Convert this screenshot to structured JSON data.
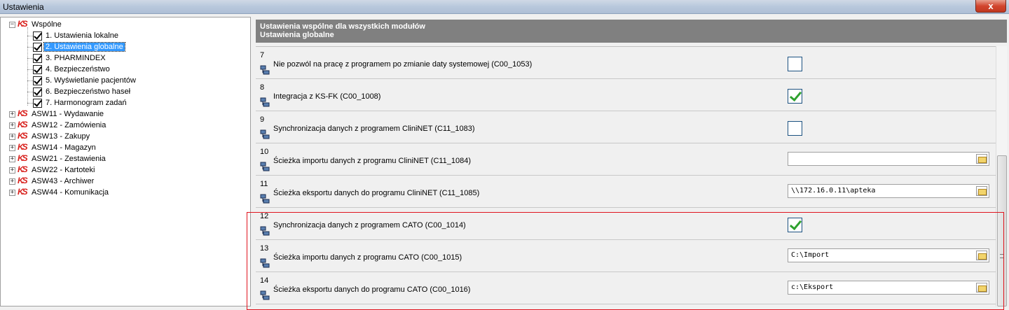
{
  "window": {
    "title": "Ustawienia",
    "close_label": "x"
  },
  "tree": {
    "root": {
      "label": "Wspólne",
      "expander": "−"
    },
    "children": [
      {
        "label": "1. Ustawienia lokalne",
        "selected": false
      },
      {
        "label": "2. Ustawienia globalne",
        "selected": true
      },
      {
        "label": "3. PHARMINDEX",
        "selected": false
      },
      {
        "label": "4. Bezpieczeństwo",
        "selected": false
      },
      {
        "label": "5. Wyświetlanie pacjentów",
        "selected": false
      },
      {
        "label": "6. Bezpieczeństwo haseł",
        "selected": false
      },
      {
        "label": "7. Harmonogram zadań",
        "selected": false
      }
    ],
    "modules": [
      {
        "label": "ASW11 - Wydawanie",
        "expander": "+"
      },
      {
        "label": "ASW12 - Zamówienia",
        "expander": "+"
      },
      {
        "label": "ASW13 - Zakupy",
        "expander": "+"
      },
      {
        "label": "ASW14 - Magazyn",
        "expander": "+"
      },
      {
        "label": "ASW21 - Zestawienia",
        "expander": "+"
      },
      {
        "label": "ASW22 - Kartoteki",
        "expander": "+"
      },
      {
        "label": "ASW43 - Archiwer",
        "expander": "+"
      },
      {
        "label": "ASW44 - Komunikacja",
        "expander": "+"
      }
    ]
  },
  "panel": {
    "header_line1": "Ustawienia wspólne dla wszystkich modułów",
    "header_line2": "Ustawienia globalne"
  },
  "settings": [
    {
      "num": "7",
      "label": "Nie pozwól na pracę z programem po zmianie daty systemowej (C00_1053)",
      "kind": "checkbox",
      "checked": false
    },
    {
      "num": "8",
      "label": "Integracja z KS-FK (C00_1008)",
      "kind": "checkbox",
      "checked": true
    },
    {
      "num": "9",
      "label": "Synchronizacja danych z programem CliniNET (C11_1083)",
      "kind": "checkbox",
      "checked": false
    },
    {
      "num": "10",
      "label": "Ścieżka importu danych z programu CliniNET (C11_1084)",
      "kind": "path",
      "value": ""
    },
    {
      "num": "11",
      "label": "Ścieżka eksportu danych do programu CliniNET (C11_1085)",
      "kind": "path",
      "value": "\\\\172.16.0.11\\apteka"
    },
    {
      "num": "12",
      "label": "Synchronizacja danych z programem CATO (C00_1014)",
      "kind": "checkbox",
      "checked": true
    },
    {
      "num": "13",
      "label": "Ścieżka importu danych z programu CATO (C00_1015)",
      "kind": "path",
      "value": "C:\\Import"
    },
    {
      "num": "14",
      "label": "Ścieżka eksportu danych do programu CATO (C00_1016)",
      "kind": "path",
      "value": "c:\\Eksport"
    }
  ],
  "colors": {
    "highlight": "#e0141e",
    "check_green": "#2ea12e",
    "header_bg": "#808080",
    "selection": "#3399ff"
  }
}
